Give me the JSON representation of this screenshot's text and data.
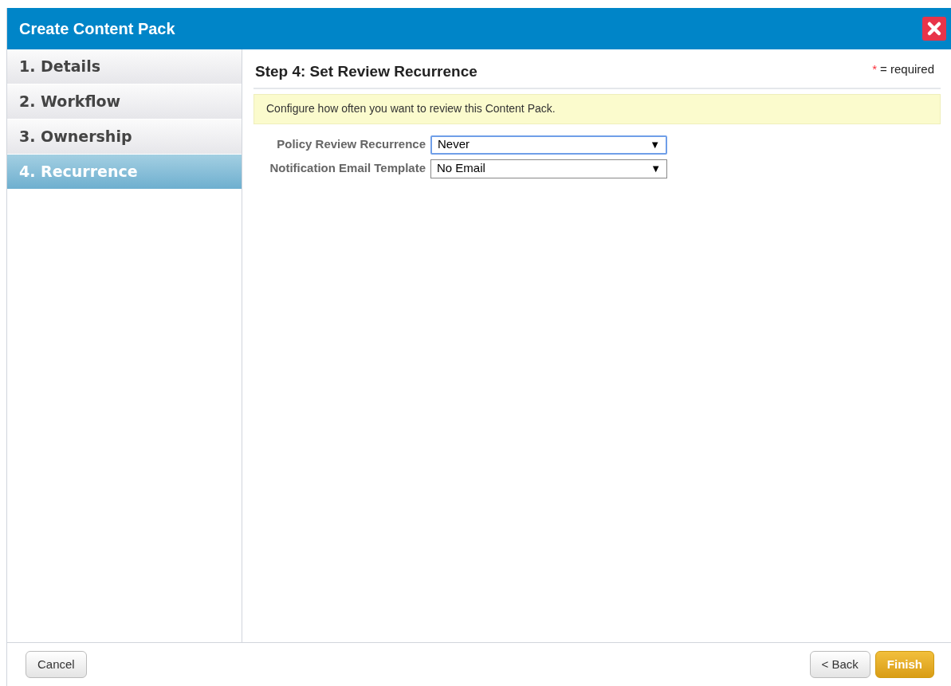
{
  "window": {
    "title": "Create Content Pack"
  },
  "steps": [
    {
      "label": "1. Details",
      "selected": false
    },
    {
      "label": "2. Workflow",
      "selected": false
    },
    {
      "label": "3. Ownership",
      "selected": false
    },
    {
      "label": "4. Recurrence",
      "selected": true
    }
  ],
  "header": {
    "title": "Step 4: Set Review Recurrence",
    "required_mark": "*",
    "required_text": "= required"
  },
  "info": "Configure how often you want to review this Content Pack.",
  "fields": [
    {
      "label": "Policy Review Recurrence",
      "value": "Never",
      "arrow": "▼",
      "focused": true
    },
    {
      "label": "Notification Email Template",
      "value": "No Email",
      "arrow": "▼",
      "focused": false
    }
  ],
  "footer": {
    "left_buttons": [
      {
        "label": "Cancel",
        "kind": "plain"
      }
    ],
    "right_buttons": [
      {
        "label": "< Back",
        "kind": "plain"
      },
      {
        "label": "Finish",
        "kind": "primary"
      }
    ]
  }
}
